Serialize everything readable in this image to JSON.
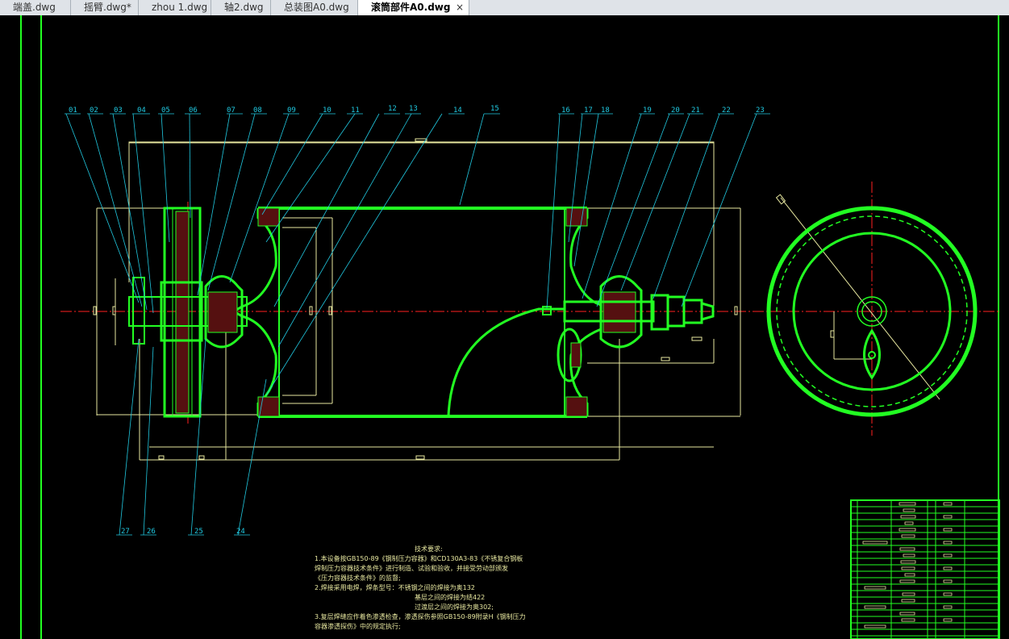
{
  "tabs": [
    {
      "label": "端盖.dwg",
      "active": false
    },
    {
      "label": "摇臂.dwg*",
      "active": false
    },
    {
      "label": "zhou 1.dwg",
      "active": false
    },
    {
      "label": "轴2.dwg",
      "active": false
    },
    {
      "label": "总装图A0.dwg",
      "active": false
    },
    {
      "label": "滚筒部件A0.dwg",
      "active": true
    }
  ],
  "close_glyph": "×",
  "drawing": {
    "part_labels_top": [
      "01",
      "02",
      "03",
      "04",
      "05",
      "06",
      "07",
      "08",
      "09",
      "10",
      "11",
      "12",
      "13",
      "14",
      "15",
      "16",
      "17",
      "18",
      "19",
      "20",
      "21",
      "22",
      "23"
    ],
    "part_labels_bottom": [
      "27",
      "26",
      "25",
      "24"
    ],
    "notes": {
      "title": "技术要求:",
      "lines": [
        "1.本设备按GB150-89《钢制压力容器》和CD130A3-83《不锈复合钢板",
        "焊制压力容器技术条件》进行制造、试验和验收，并接受劳动部颁发",
        "《压力容器技术条件》的监督;",
        "2.焊接采用电焊，焊条型号：不锈钢之间的焊接为奥132",
        "基层之间的焊接为结422",
        "过渡层之间的焊接为奥302;",
        "3.复层焊缝应作着色渗透检查，渗透探伤参照GB150-89附录H《钢制压力",
        "容器渗透探伤》中的规定执行;"
      ]
    },
    "colors": {
      "background": "#000000",
      "part_outline": "#22ff22",
      "leader": "#20c8e0",
      "dimension": "#e8e8a0",
      "centerline": "#ff2020",
      "hatch": "#ff3030",
      "frame": "#22ff22"
    }
  }
}
